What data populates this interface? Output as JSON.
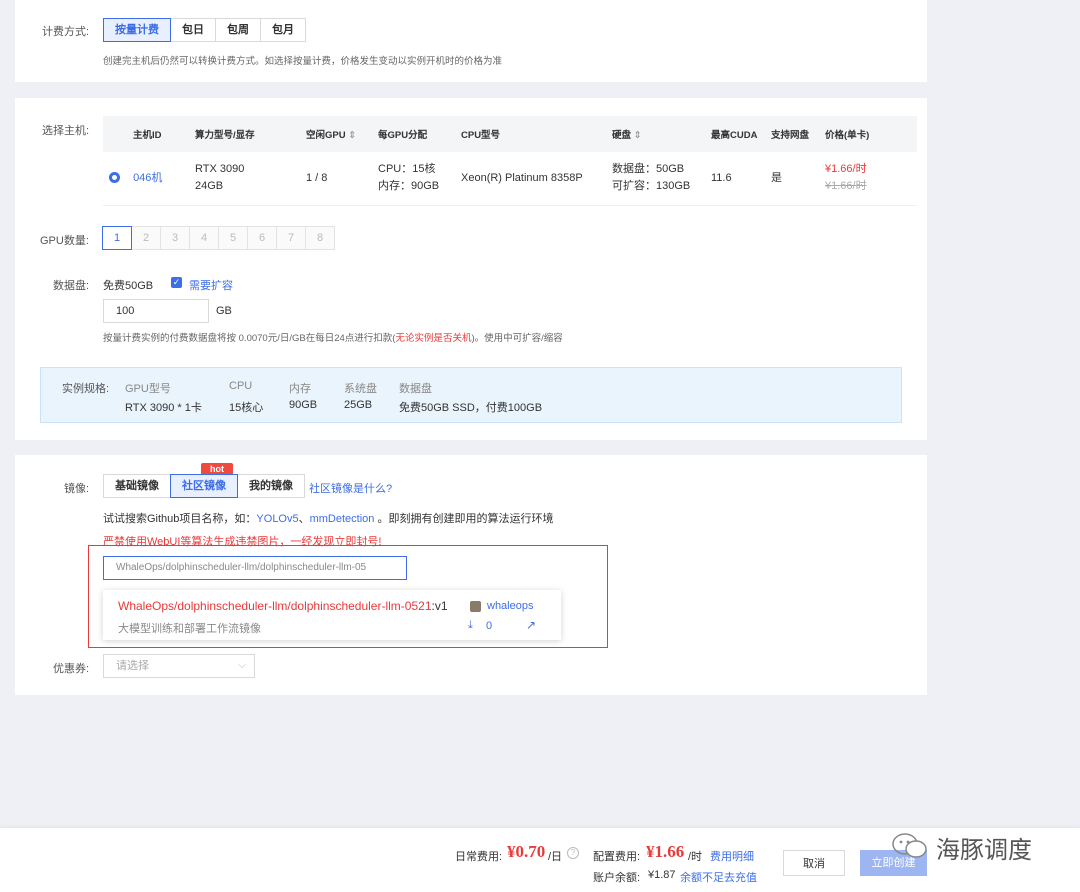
{
  "billing": {
    "label": "计费方式:",
    "options": [
      "按量计费",
      "包日",
      "包周",
      "包月"
    ],
    "hint": "创建完主机后仍然可以转换计费方式。如选择按量计费，价格发生变动以实例开机时的价格为准"
  },
  "host": {
    "label": "选择主机:",
    "columns": [
      "主机ID",
      "算力型号/显存",
      "空闲GPU",
      "每GPU分配",
      "CPU型号",
      "硬盘",
      "最高CUDA",
      "支持网盘",
      "价格(单卡)"
    ],
    "sort_glyph": "⇕",
    "row": {
      "id": "046机",
      "model": "RTX 3090",
      "vram": "24GB",
      "free_gpu": "1 / 8",
      "cpu_alloc": "CPU：15核",
      "mem_alloc": "内存：90GB",
      "cpu_model": "Xeon(R) Platinum 8358P",
      "disk": "数据盘：50GB",
      "disk_ext": "可扩容：130GB",
      "cuda": "11.6",
      "netdisk": "是",
      "price": "¥1.66/时",
      "price_old": "¥1.66/时"
    }
  },
  "gpu_count": {
    "label": "GPU数量:",
    "options": [
      "1",
      "2",
      "3",
      "4",
      "5",
      "6",
      "7",
      "8"
    ]
  },
  "data_disk": {
    "label": "数据盘:",
    "free": "免费50GB",
    "expand_label": "需要扩容",
    "value": "100",
    "unit": "GB",
    "hint_a": "按量计费实例的付费数据盘将按 0.0070元/日/GB在每日24点进行扣款(",
    "hint_red": "无论实例是否关机",
    "hint_b": ")。使用中可扩容/缩容"
  },
  "spec": {
    "label": "实例规格:",
    "keys": [
      "GPU型号",
      "CPU",
      "内存",
      "系统盘",
      "数据盘"
    ],
    "values": [
      "RTX 3090 * 1卡",
      "15核心",
      "90GB",
      "25GB",
      "免费50GB SSD，付费100GB"
    ]
  },
  "image": {
    "label": "镜像:",
    "options": [
      "基础镜像",
      "社区镜像",
      "我的镜像"
    ],
    "hot": "hot",
    "what_link": "社区镜像是什么?",
    "try_a": "试试搜索Github项目名称，如：",
    "try_link1": "YOLOv5",
    "try_sep": "、",
    "try_link2": "mmDetection",
    "try_b": " 。即刻拥有创建即用的算法运行环境",
    "warning": "严禁使用WebUI等算法生成违禁图片，一经发现立即封号!",
    "search_value": "WhaleOps/dolphinscheduler-llm/dolphinscheduler-llm-05",
    "result_name": "WhaleOps/dolphinscheduler-llm/dolphinscheduler-llm-0521",
    "result_ver": ":v1",
    "result_user": "whaleops",
    "result_desc": "大模型训练和部署工作流镜像",
    "result_downloads": "0"
  },
  "coupon": {
    "label": "优惠券:",
    "placeholder": "请选择"
  },
  "footer": {
    "daily_label": "日常费用:",
    "daily_value": "¥0.70",
    "daily_unit": "/日",
    "config_label": "配置费用:",
    "config_value": "¥1.66",
    "config_unit": "/时",
    "detail_link": "费用明细",
    "balance_label": "账户余额:",
    "balance_value": "¥1.87",
    "recharge_link": "余额不足去充值",
    "cancel": "取消",
    "create": "立即创建"
  },
  "watermark": "海豚调度",
  "colors": {
    "accent": "#3d6ee8",
    "danger": "#e83a3a",
    "hot": "#f04a3e"
  }
}
